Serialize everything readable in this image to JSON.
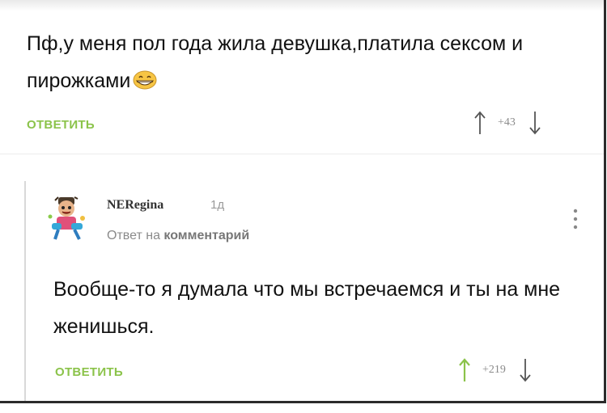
{
  "comment1": {
    "text": "Пф,у меня пол года жила девушка,платила сексом и пирожками",
    "emoji": "grinning-face-emoji",
    "reply_label": "ОТВЕТИТЬ",
    "rating": "+43"
  },
  "comment2": {
    "username": "NERegina",
    "time": "1д",
    "reply_to_prefix": "Ответ на",
    "reply_to_link": "комментарий",
    "text": "Вообще-то я думала что мы встречаемся и ты на мне женишься.",
    "reply_label": "ОТВЕТИТЬ",
    "rating": "+219"
  },
  "colors": {
    "accent_green": "#8bc34a",
    "text": "#111111",
    "muted": "#8a8a8a"
  }
}
